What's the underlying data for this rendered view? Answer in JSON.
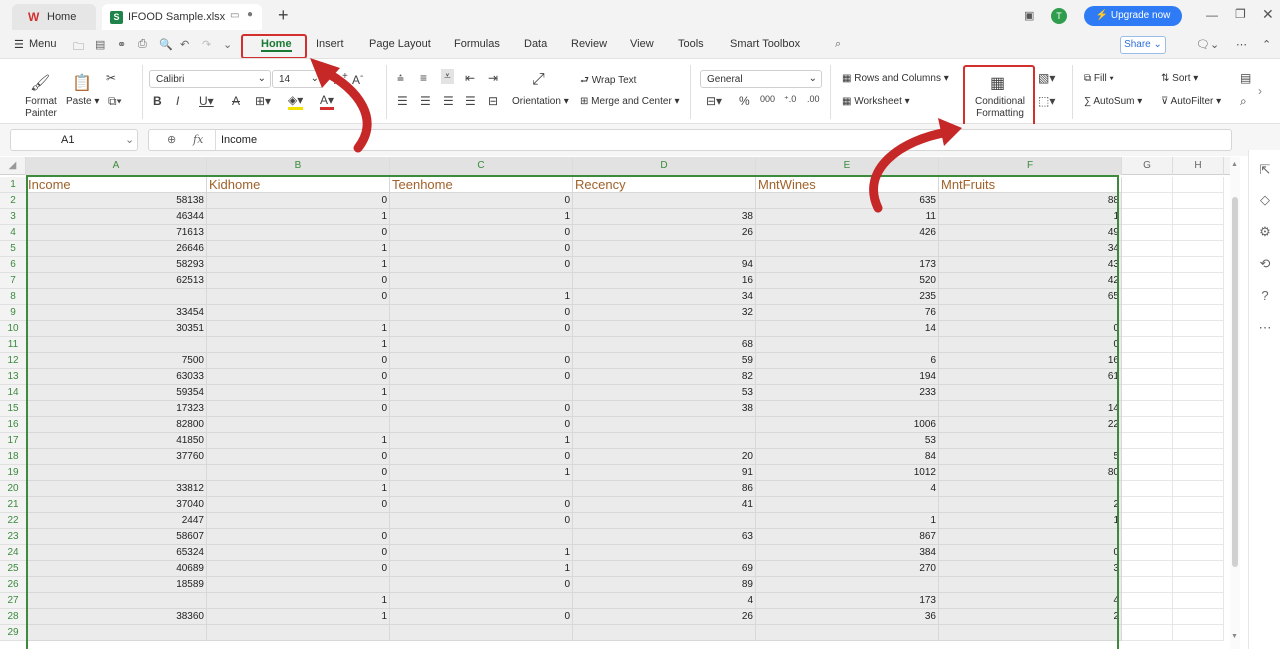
{
  "tabs": {
    "home_label": "Home",
    "file_label": "IFOOD Sample.xlsx",
    "add_label": "+"
  },
  "menu": {
    "menu_label": "Menu",
    "items": [
      "Home",
      "Insert",
      "Page Layout",
      "Formulas",
      "Data",
      "Review",
      "View",
      "Tools",
      "Smart Toolbox"
    ]
  },
  "topright": {
    "upgrade_label": "Upgrade now",
    "share_label": "Share",
    "avatar_letter": "T"
  },
  "ribbon": {
    "format_painter": "Format Painter",
    "paste": "Paste",
    "font_name": "Calibri",
    "font_size": "14",
    "orientation": "Orientation",
    "wrap_text": "Wrap Text",
    "merge_center": "Merge and Center",
    "number_format": "General",
    "rows_columns": "Rows and Columns",
    "worksheet": "Worksheet",
    "conditional_formatting": "Conditional Formatting",
    "fill": "Fill",
    "sort": "Sort",
    "autosum": "AutoSum",
    "autofilter": "AutoFilter"
  },
  "formula": {
    "cell_ref": "A1",
    "content": "Income",
    "fx": "fx"
  },
  "columns": [
    "A",
    "B",
    "C",
    "D",
    "E",
    "F",
    "G",
    "H"
  ],
  "headers": [
    "Income",
    "Kidhome",
    "Teenhome",
    "Recency",
    "MntWines",
    "MntFruits"
  ],
  "rows": [
    [
      "58138",
      "0",
      "0",
      "",
      "635",
      "88"
    ],
    [
      "46344",
      "1",
      "1",
      "38",
      "11",
      "1"
    ],
    [
      "71613",
      "0",
      "0",
      "26",
      "426",
      "49"
    ],
    [
      "26646",
      "1",
      "0",
      "",
      "",
      "34"
    ],
    [
      "58293",
      "1",
      "0",
      "94",
      "173",
      "43"
    ],
    [
      "62513",
      "0",
      "",
      "16",
      "520",
      "42"
    ],
    [
      "",
      "0",
      "1",
      "34",
      "235",
      "65"
    ],
    [
      "33454",
      "",
      "0",
      "32",
      "76",
      ""
    ],
    [
      "30351",
      "1",
      "0",
      "",
      "14",
      "0"
    ],
    [
      "",
      "1",
      "",
      "68",
      "",
      "0"
    ],
    [
      "7500",
      "0",
      "0",
      "59",
      "6",
      "16"
    ],
    [
      "63033",
      "0",
      "0",
      "82",
      "194",
      "61"
    ],
    [
      "59354",
      "1",
      "",
      "53",
      "233",
      ""
    ],
    [
      "17323",
      "0",
      "0",
      "38",
      "",
      "14"
    ],
    [
      "82800",
      "",
      "0",
      "",
      "1006",
      "22"
    ],
    [
      "41850",
      "1",
      "1",
      "",
      "53",
      ""
    ],
    [
      "37760",
      "0",
      "0",
      "20",
      "84",
      "5"
    ],
    [
      "",
      "0",
      "1",
      "91",
      "1012",
      "80"
    ],
    [
      "33812",
      "1",
      "",
      "86",
      "4",
      ""
    ],
    [
      "37040",
      "0",
      "0",
      "41",
      "",
      "2"
    ],
    [
      "2447",
      "",
      "0",
      "",
      "1",
      "1"
    ],
    [
      "58607",
      "0",
      "",
      "63",
      "867",
      ""
    ],
    [
      "65324",
      "0",
      "1",
      "",
      "384",
      "0"
    ],
    [
      "40689",
      "0",
      "1",
      "69",
      "270",
      "3"
    ],
    [
      "18589",
      "",
      "0",
      "89",
      "",
      ""
    ],
    [
      "",
      "1",
      "",
      "4",
      "173",
      "4"
    ],
    [
      "38360",
      "1",
      "0",
      "26",
      "36",
      "2"
    ],
    [
      "",
      "",
      "",
      "",
      "",
      ""
    ]
  ],
  "colors": {
    "accent_red": "#d32f2f",
    "header_text": "#a0622a",
    "selection_green": "#3c8a3c",
    "upgrade_blue": "#2f7bf5"
  }
}
